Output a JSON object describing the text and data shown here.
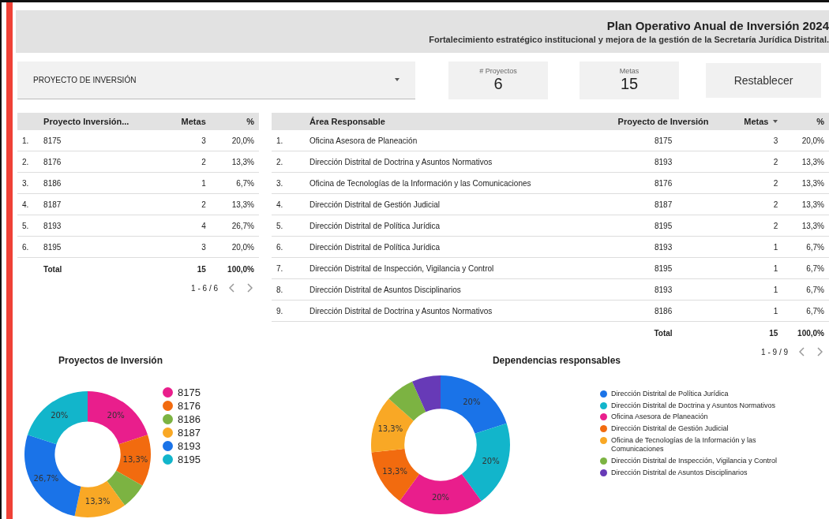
{
  "header": {
    "title": "Plan Operativo Anual de Inversión 2024",
    "subtitle": "Fortalecimiento estratégico institucional y mejora de la gestión de la Secretaría Jurídica Distrital."
  },
  "filter": {
    "label": "PROYECTO DE INVERSIÓN"
  },
  "scorecards": [
    {
      "label": "# Proyectos",
      "value": "6"
    },
    {
      "label": "Metas",
      "value": "15"
    }
  ],
  "reset_button": "Restablecer",
  "projects_table": {
    "columns": [
      "Proyecto Inversión...",
      "Metas",
      "%"
    ],
    "rows": [
      {
        "index": "1.",
        "project": "8175",
        "metas": "3",
        "percent": "20,0%"
      },
      {
        "index": "2.",
        "project": "8176",
        "metas": "2",
        "percent": "13,3%"
      },
      {
        "index": "3.",
        "project": "8186",
        "metas": "1",
        "percent": "6,7%"
      },
      {
        "index": "4.",
        "project": "8187",
        "metas": "2",
        "percent": "13,3%"
      },
      {
        "index": "5.",
        "project": "8193",
        "metas": "4",
        "percent": "26,7%"
      },
      {
        "index": "6.",
        "project": "8195",
        "metas": "3",
        "percent": "20,0%"
      }
    ],
    "total": {
      "label": "Total",
      "metas": "15",
      "percent": "100,0%"
    },
    "pagination": "1 - 6 / 6"
  },
  "areas_table": {
    "columns": [
      "Área Responsable",
      "Proyecto de Inversión",
      "Metas",
      "%"
    ],
    "rows": [
      {
        "index": "1.",
        "area": "Oficina Asesora de Planeación",
        "project": "8175",
        "metas": "3",
        "percent": "20,0%"
      },
      {
        "index": "2.",
        "area": "Dirección Distrital de Doctrina y Asuntos Normativos",
        "project": "8193",
        "metas": "2",
        "percent": "13,3%"
      },
      {
        "index": "3.",
        "area": "Oficina de Tecnologías de la Información y las Comunicaciones",
        "project": "8176",
        "metas": "2",
        "percent": "13,3%"
      },
      {
        "index": "4.",
        "area": "Dirección Distrital de Gestión Judicial",
        "project": "8187",
        "metas": "2",
        "percent": "13,3%"
      },
      {
        "index": "5.",
        "area": "Dirección Distrital de Política Jurídica",
        "project": "8195",
        "metas": "2",
        "percent": "13,3%"
      },
      {
        "index": "6.",
        "area": "Dirección Distrital de Política Jurídica",
        "project": "8193",
        "metas": "1",
        "percent": "6,7%"
      },
      {
        "index": "7.",
        "area": "Dirección Distrital de Inspección, Vigilancia y Control",
        "project": "8195",
        "metas": "1",
        "percent": "6,7%"
      },
      {
        "index": "8.",
        "area": "Dirección Distrital de Asuntos Disciplinarios",
        "project": "8193",
        "metas": "1",
        "percent": "6,7%"
      },
      {
        "index": "9.",
        "area": "Dirección Distrital de Doctrina y Asuntos Normativos",
        "project": "8186",
        "metas": "1",
        "percent": "6,7%"
      }
    ],
    "total": {
      "label": "Total",
      "metas": "15",
      "percent": "100,0%"
    },
    "pagination": "1 - 9 / 9"
  },
  "projects_chart": {
    "chart_data": {
      "type": "donut",
      "title": "Proyectos de Inversión",
      "categories": [
        "8175",
        "8176",
        "8186",
        "8187",
        "8193",
        "8195"
      ],
      "values": [
        20,
        13.3,
        6.7,
        13.3,
        26.7,
        20
      ],
      "colors": [
        "#e91e8c",
        "#f26b0f",
        "#7cb342",
        "#f9a825",
        "#1a73e8",
        "#12b5cb"
      ],
      "data_labels": true,
      "value_labels": [
        "20%",
        "13,3%",
        null,
        "13,3%",
        "26,7%",
        "20%"
      ]
    }
  },
  "areas_chart": {
    "chart_data": {
      "type": "donut",
      "title": "Dependencias responsables",
      "categories": [
        "Dirección Distrital de Política Jurídica",
        "Dirección Distrital de Doctrina y Asuntos Normativos",
        "Oficina Asesora de Planeación",
        "Dirección Distrital de Gestión Judicial",
        "Oficina de Tecnologías de la Información y las Comunicaciones",
        "Dirección Distrital de Inspección, Vigilancia y Control",
        "Dirección Distrital de Asuntos Disciplinarios"
      ],
      "values": [
        20,
        20,
        20,
        13.3,
        13.3,
        6.7,
        6.7
      ],
      "colors": [
        "#1a73e8",
        "#12b5cb",
        "#e91e8c",
        "#f26b0f",
        "#f9a825",
        "#7cb342",
        "#673ab7"
      ],
      "data_labels": true,
      "value_labels": [
        "20%",
        "20%",
        "20%",
        "13,3%",
        "13,3%",
        null,
        null
      ]
    }
  }
}
